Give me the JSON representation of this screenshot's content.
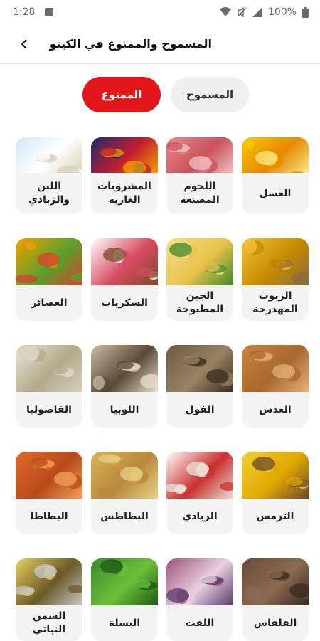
{
  "status": {
    "time": "1:28",
    "battery": "100%"
  },
  "header": {
    "title": "المسموح والممنوع في الكيتو"
  },
  "tabs": [
    {
      "label": "المسموح"
    },
    {
      "label": "الممنوع"
    }
  ],
  "items": [
    {
      "label": "العسل",
      "icon": "honey-image"
    },
    {
      "label": "اللحوم المصنعة",
      "icon": "processed-meat-image"
    },
    {
      "label": "المشروبات الغازية",
      "icon": "soft-drinks-image"
    },
    {
      "label": "اللبن والزبادي",
      "icon": "milk-yogurt-image"
    },
    {
      "label": "الزيوت المهدرجة",
      "icon": "hydrogenated-oils-image"
    },
    {
      "label": "الجبن المطبوخة",
      "icon": "processed-cheese-image"
    },
    {
      "label": "السكريات",
      "icon": "sweets-image"
    },
    {
      "label": "العصائر",
      "icon": "juices-image"
    },
    {
      "label": "العدس",
      "icon": "lentils-image"
    },
    {
      "label": "الفول",
      "icon": "fava-beans-image"
    },
    {
      "label": "اللوبيا",
      "icon": "black-eyed-peas-image"
    },
    {
      "label": "الفاصوليا",
      "icon": "white-beans-image"
    },
    {
      "label": "الترمس",
      "icon": "lupini-image"
    },
    {
      "label": "الزبادي",
      "icon": "yogurt-image"
    },
    {
      "label": "البطاطس",
      "icon": "potatoes-image"
    },
    {
      "label": "البطاطا",
      "icon": "sweet-potato-image"
    },
    {
      "label": "القلقاس",
      "icon": "taro-image"
    },
    {
      "label": "اللفت",
      "icon": "turnip-image"
    },
    {
      "label": "البسلة",
      "icon": "peas-image"
    },
    {
      "label": "السمن النباتي",
      "icon": "margarine-image"
    }
  ],
  "colors": {
    "accent": "#e3161b",
    "card": "#f3f3f3"
  }
}
